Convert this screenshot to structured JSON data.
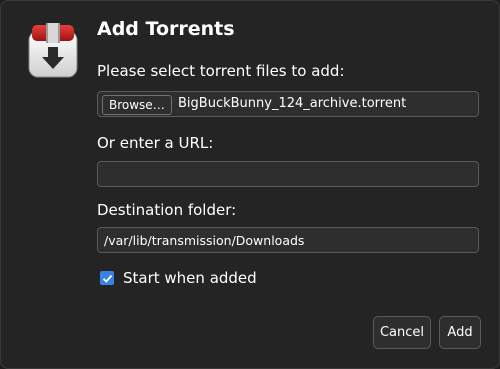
{
  "dialog": {
    "title": "Add Torrents",
    "app_icon": "transmission-icon"
  },
  "torrent_files": {
    "label": "Please select torrent files to add:",
    "browse_label": "Browse…",
    "selected_file": "BigBuckBunny_124_archive.torrent"
  },
  "url": {
    "label": "Or enter a URL:",
    "value": ""
  },
  "destination": {
    "label": "Destination folder:",
    "value": "/var/lib/transmission/Downloads"
  },
  "start_when_added": {
    "label": "Start when added",
    "checked": true
  },
  "buttons": {
    "cancel": "Cancel",
    "add": "Add"
  },
  "colors": {
    "background": "#242424",
    "field": "#2e2e2e",
    "accent": "#3584e4",
    "icon_red": "#c81e1e"
  }
}
